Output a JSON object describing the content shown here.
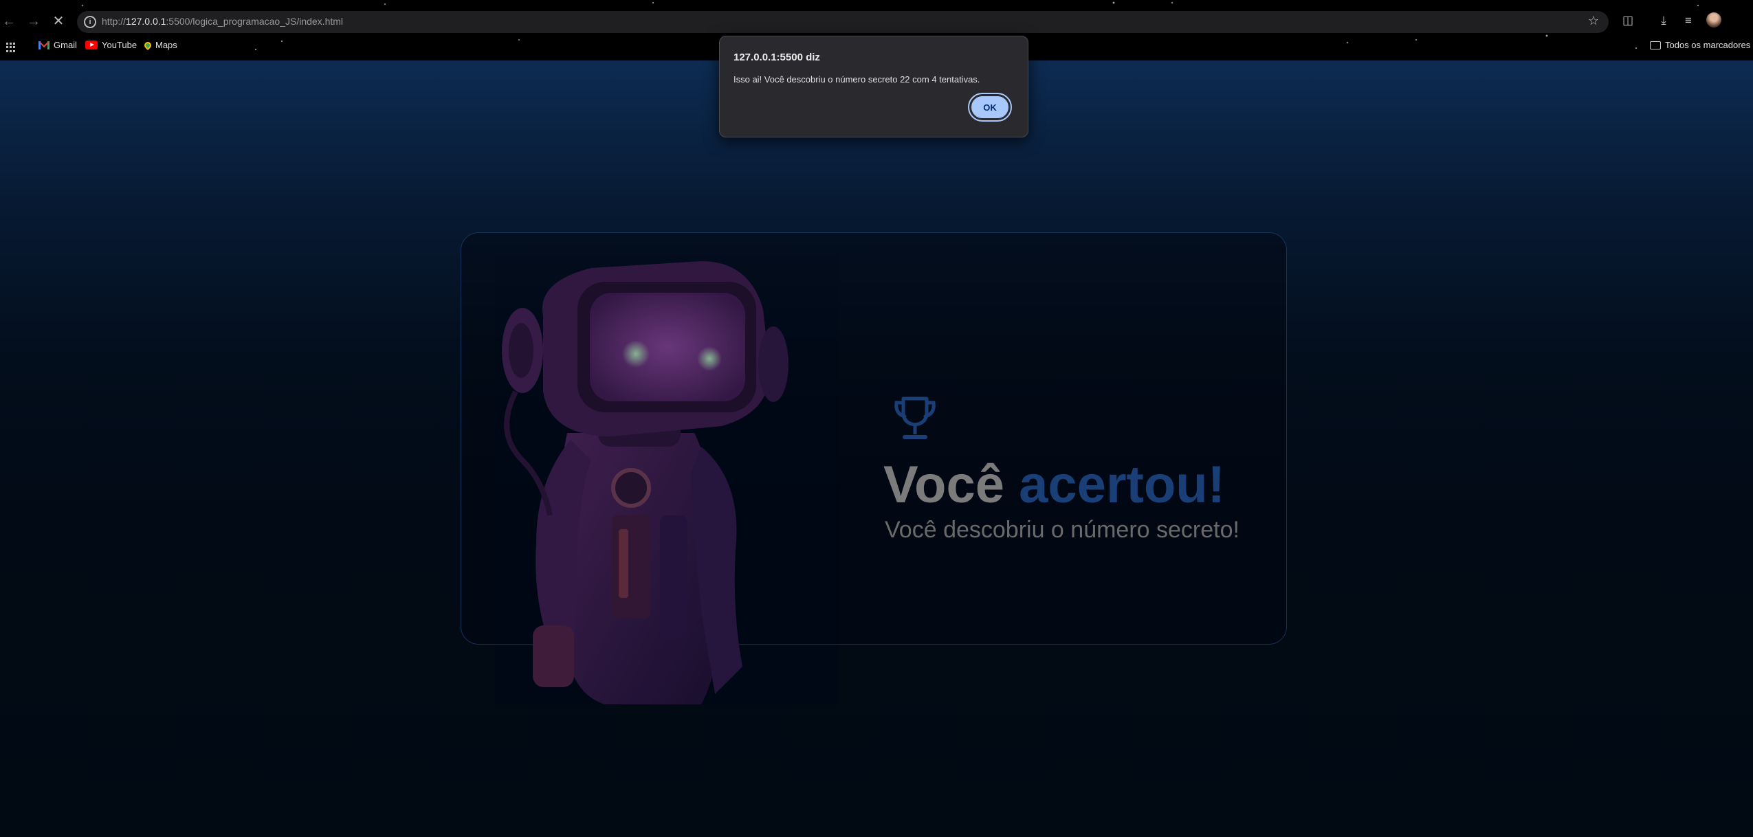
{
  "browser": {
    "url_prefix": "http://",
    "url_host": "127.0.0.1",
    "url_rest": ":5500/logica_programacao_JS/index.html",
    "bookmarks": [
      {
        "label": "Gmail",
        "icon": "gmail-icon"
      },
      {
        "label": "YouTube",
        "icon": "youtube-icon"
      },
      {
        "label": "Maps",
        "icon": "maps-icon"
      }
    ],
    "all_bookmarks_label": "Todos os marcadores"
  },
  "page": {
    "trophy_icon": "trophy-icon",
    "headline_part1": "Você",
    "headline_part2": "acertou!",
    "subheadline": "Você descobriu o número secreto!",
    "colors": {
      "headline_grey": "#7b7b7b",
      "headline_blue": "#1a3f77",
      "card_border": "#17335a"
    }
  },
  "alert": {
    "title": "127.0.0.1:5500 diz",
    "message": "Isso ai! Você descobriu o número secreto 22 com 4 tentativas.",
    "ok_label": "OK"
  }
}
